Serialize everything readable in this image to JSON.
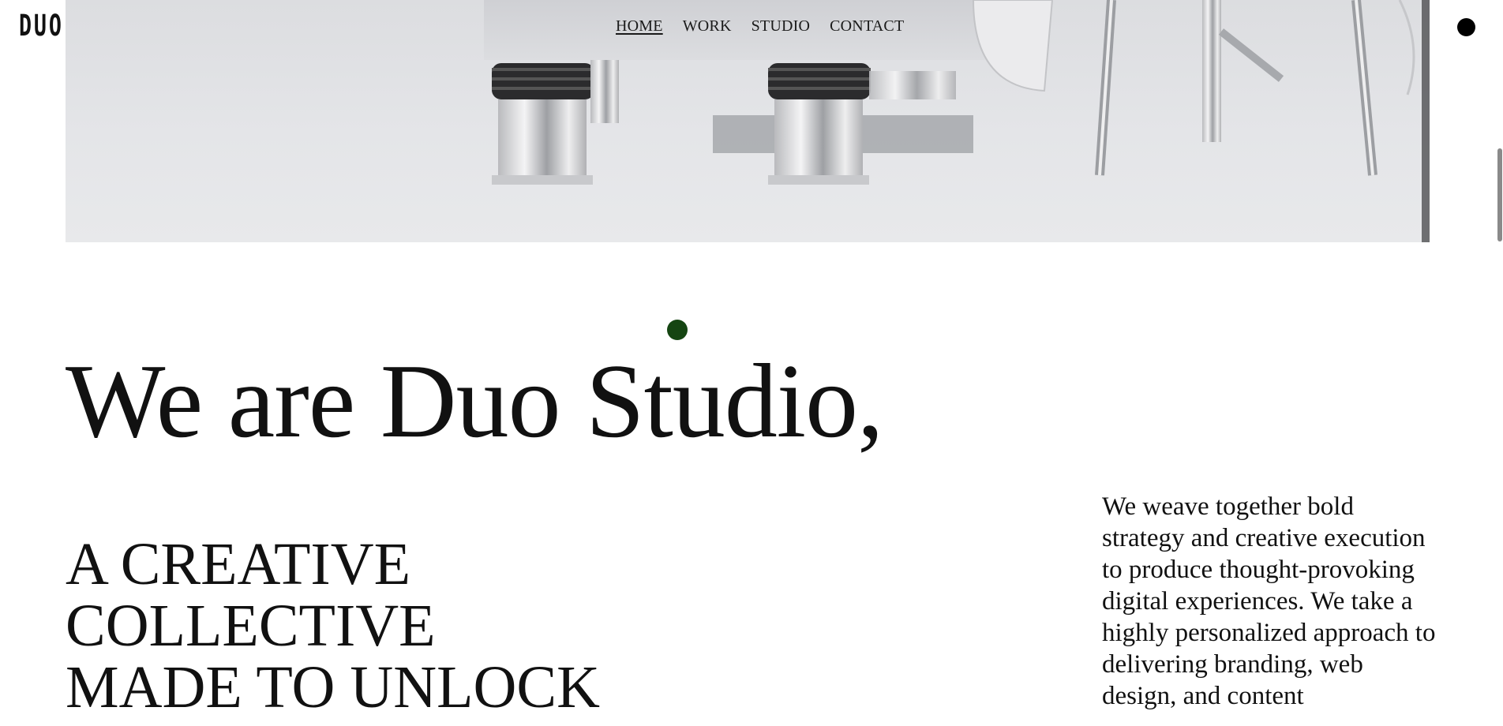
{
  "header": {
    "logo_text": "DUO",
    "nav": [
      {
        "label": "HOME",
        "active": true
      },
      {
        "label": "WORK",
        "active": false
      },
      {
        "label": "STUDIO",
        "active": false
      },
      {
        "label": "CONTACT",
        "active": false
      }
    ],
    "menu_icon": "filled-circle-menu-icon"
  },
  "hero": {
    "image_subject": "chrome machine legs on grey studio floor"
  },
  "intro": {
    "headline": "We are Duo Studio,",
    "tagline_lines": [
      "A CREATIVE",
      "COLLECTIVE",
      "MADE TO UNLOCK"
    ],
    "blurb": "We weave together bold strategy and creative execution to produce thought-provoking digital experiences. We take a highly personalized approach to delivering branding, web design, and content"
  },
  "colors": {
    "background": "#ffffff",
    "text": "#111111",
    "accent_dot": "#154512",
    "hero_bg": "#e2e3e6"
  }
}
